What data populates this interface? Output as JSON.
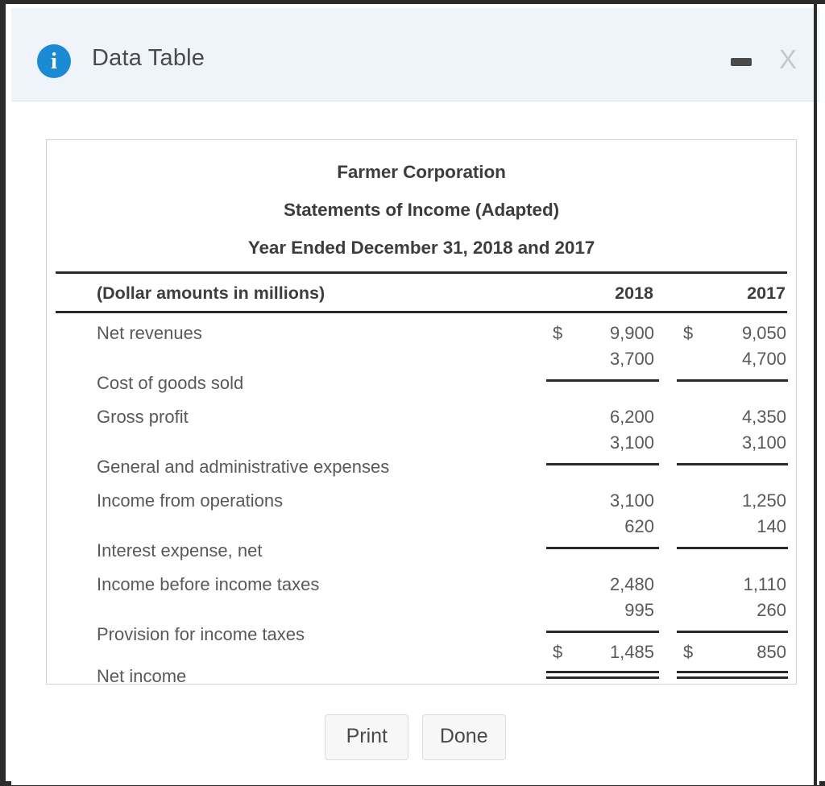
{
  "window": {
    "title": "Data Table",
    "icon": "info-icon",
    "minimize_label": "",
    "close_label": "X"
  },
  "statement": {
    "company": "Farmer Corporation",
    "statement_title": "Statements of Income (Adapted)",
    "period": "Year Ended December 31, 2018 and 2017",
    "units_label": "(Dollar amounts in millions)",
    "columns": [
      "2018",
      "2017"
    ],
    "currency_symbol": "$",
    "rows": [
      {
        "label": "Net revenues",
        "cur_2018": "$",
        "v2018": "9,900",
        "cur_2017": "$",
        "v2017": "9,050",
        "rule": "none",
        "raised": false
      },
      {
        "label": "Cost of goods sold",
        "cur_2018": "",
        "v2018": "3,700",
        "cur_2017": "",
        "v2017": "4,700",
        "rule": "single",
        "raised": true
      },
      {
        "label": "Gross profit",
        "cur_2018": "",
        "v2018": "6,200",
        "cur_2017": "",
        "v2017": "4,350",
        "rule": "none",
        "raised": false
      },
      {
        "label": "General and administrative expenses",
        "cur_2018": "",
        "v2018": "3,100",
        "cur_2017": "",
        "v2017": "3,100",
        "rule": "single",
        "raised": true
      },
      {
        "label": "Income from operations",
        "cur_2018": "",
        "v2018": "3,100",
        "cur_2017": "",
        "v2017": "1,250",
        "rule": "none",
        "raised": false
      },
      {
        "label": "Interest expense, net",
        "cur_2018": "",
        "v2018": "620",
        "cur_2017": "",
        "v2017": "140",
        "rule": "single",
        "raised": true
      },
      {
        "label": "Income before income taxes",
        "cur_2018": "",
        "v2018": "2,480",
        "cur_2017": "",
        "v2017": "1,110",
        "rule": "none",
        "raised": false
      },
      {
        "label": "Provision for income taxes",
        "cur_2018": "",
        "v2018": "995",
        "cur_2017": "",
        "v2017": "260",
        "rule": "single",
        "raised": true
      },
      {
        "label": "Net income",
        "cur_2018": "$",
        "v2018": "1,485",
        "cur_2017": "$",
        "v2017": "850",
        "rule": "double",
        "raised": true
      }
    ]
  },
  "footer": {
    "print_label": "Print",
    "done_label": "Done"
  },
  "colors": {
    "titlebar_bg": "#eff4fb",
    "info_blue": "#1b8ad4",
    "text_gray": "#595959",
    "heading_gray": "#3d3d3d",
    "rule_black": "#2a2a2a",
    "button_bg": "#f7f7f7"
  }
}
